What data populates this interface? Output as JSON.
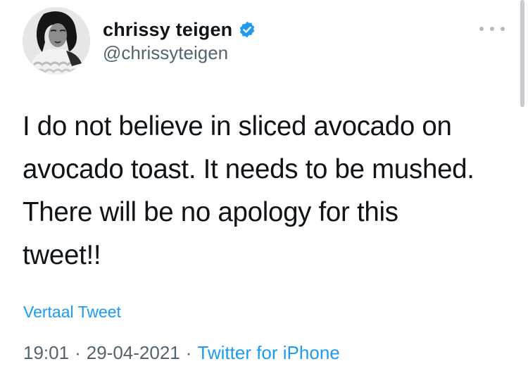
{
  "author": {
    "display_name": "chrissy teigen",
    "handle": "@chrissyteigen",
    "verified": true,
    "avatar_icon": "profile-photo"
  },
  "tweet": {
    "text": "I do not believe in sliced avocado on\navocado toast. It needs to be mushed.\nThere will be no apology for this\ntweet!!",
    "translate_label": "Vertaal Tweet",
    "time": "19:01",
    "date": "29-04-2021",
    "separator": "·",
    "source": "Twitter for iPhone"
  },
  "icons": {
    "more": "more-horizontal-icon",
    "verified": "verified-badge-icon"
  },
  "colors": {
    "link": "#1d9bf0",
    "secondary": "#536471",
    "verified": "#1d9bf0"
  }
}
